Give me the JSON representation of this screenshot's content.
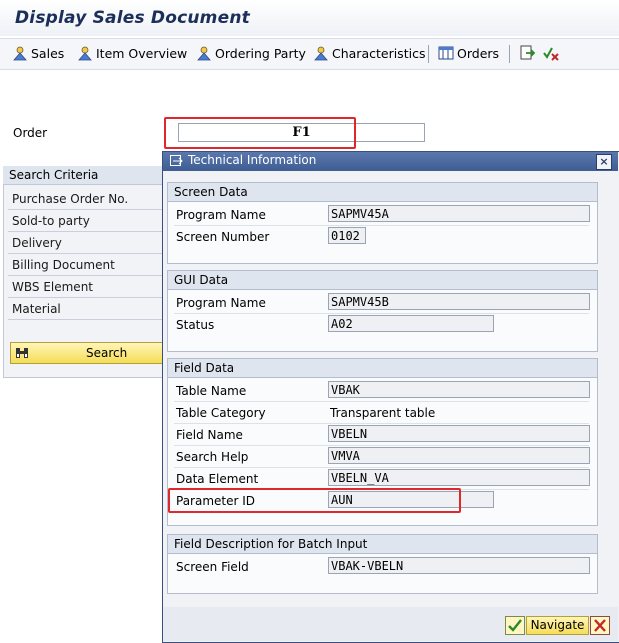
{
  "window": {
    "title": "Display Sales Document"
  },
  "toolbar": {
    "sales": "Sales",
    "item_overview": "Item Overview",
    "ordering_party": "Ordering Party",
    "characteristics": "Characteristics",
    "orders": "Orders"
  },
  "order": {
    "label": "Order",
    "value": "F1"
  },
  "search_criteria": {
    "title": "Search Criteria",
    "items": [
      "Purchase Order No.",
      "Sold-to party",
      "Delivery",
      "Billing Document",
      "WBS Element",
      "Material"
    ],
    "button": "Search"
  },
  "dialog": {
    "title": "Technical Information",
    "screen_data": {
      "title": "Screen Data",
      "program_name_label": "Program Name",
      "program_name": "SAPMV45A",
      "screen_number_label": "Screen Number",
      "screen_number": "0102"
    },
    "gui_data": {
      "title": "GUI Data",
      "program_name_label": "Program Name",
      "program_name": "SAPMV45B",
      "status_label": "Status",
      "status": "A02"
    },
    "field_data": {
      "title": "Field Data",
      "table_name_label": "Table Name",
      "table_name": "VBAK",
      "table_category_label": "Table Category",
      "table_category": "Transparent table",
      "field_name_label": "Field Name",
      "field_name": "VBELN",
      "search_help_label": "Search Help",
      "search_help": "VMVA",
      "data_element_label": "Data Element",
      "data_element": "VBELN_VA",
      "parameter_id_label": "Parameter ID",
      "parameter_id": "AUN"
    },
    "batch_input": {
      "title": "Field Description for Batch Input",
      "screen_field_label": "Screen Field",
      "screen_field": "VBAK-VBELN"
    },
    "navigate_button": "Navigate"
  },
  "colors": {
    "highlight": "#e0282c",
    "dialog_title": "#3e5d93",
    "button": "#f5dd57"
  }
}
